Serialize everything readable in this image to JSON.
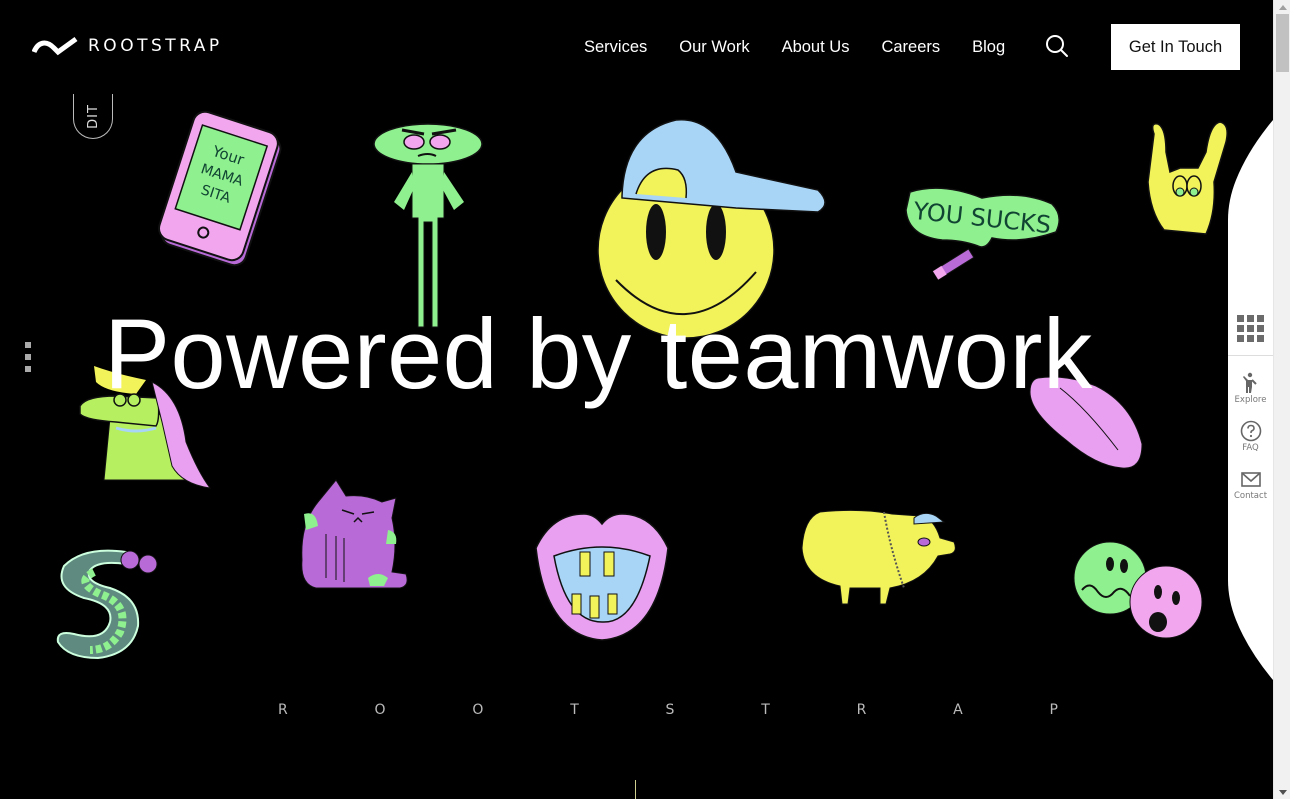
{
  "brand": {
    "name": "ROOTSTRAP",
    "logo_icon": "rootstrap-wave-check-icon"
  },
  "nav": {
    "items": [
      {
        "label": "Services"
      },
      {
        "label": "Our Work"
      },
      {
        "label": "About Us"
      },
      {
        "label": "Careers"
      },
      {
        "label": "Blog"
      }
    ],
    "search_icon": "search-icon",
    "cta_label": "Get In Touch"
  },
  "edit_pill": {
    "label": "DIT"
  },
  "hero": {
    "title": "Powered by teamwork",
    "spaced_wordmark": [
      "R",
      "O",
      "O",
      "T",
      "S",
      "T",
      "R",
      "A",
      "P"
    ]
  },
  "stickers": {
    "phone_text": [
      "Your",
      "MAMA",
      "SITA"
    ],
    "speech_text": "YOU SUCKS"
  },
  "side_widget": {
    "grid_icon": "apps-grid-icon",
    "items": [
      {
        "label": "Explore",
        "icon": "person-waving-icon"
      },
      {
        "label": "FAQ",
        "icon": "question-circle-icon"
      },
      {
        "label": "Contact",
        "icon": "envelope-icon"
      }
    ]
  },
  "colors": {
    "background": "#000000",
    "text": "#ffffff",
    "cta_bg": "#ffffff",
    "sticker_pink": "#e9a0f0",
    "sticker_green": "#8ef08e",
    "sticker_yellow": "#f2f25a",
    "sticker_blue": "#a8d4f5",
    "sticker_purple": "#b86ad6"
  }
}
